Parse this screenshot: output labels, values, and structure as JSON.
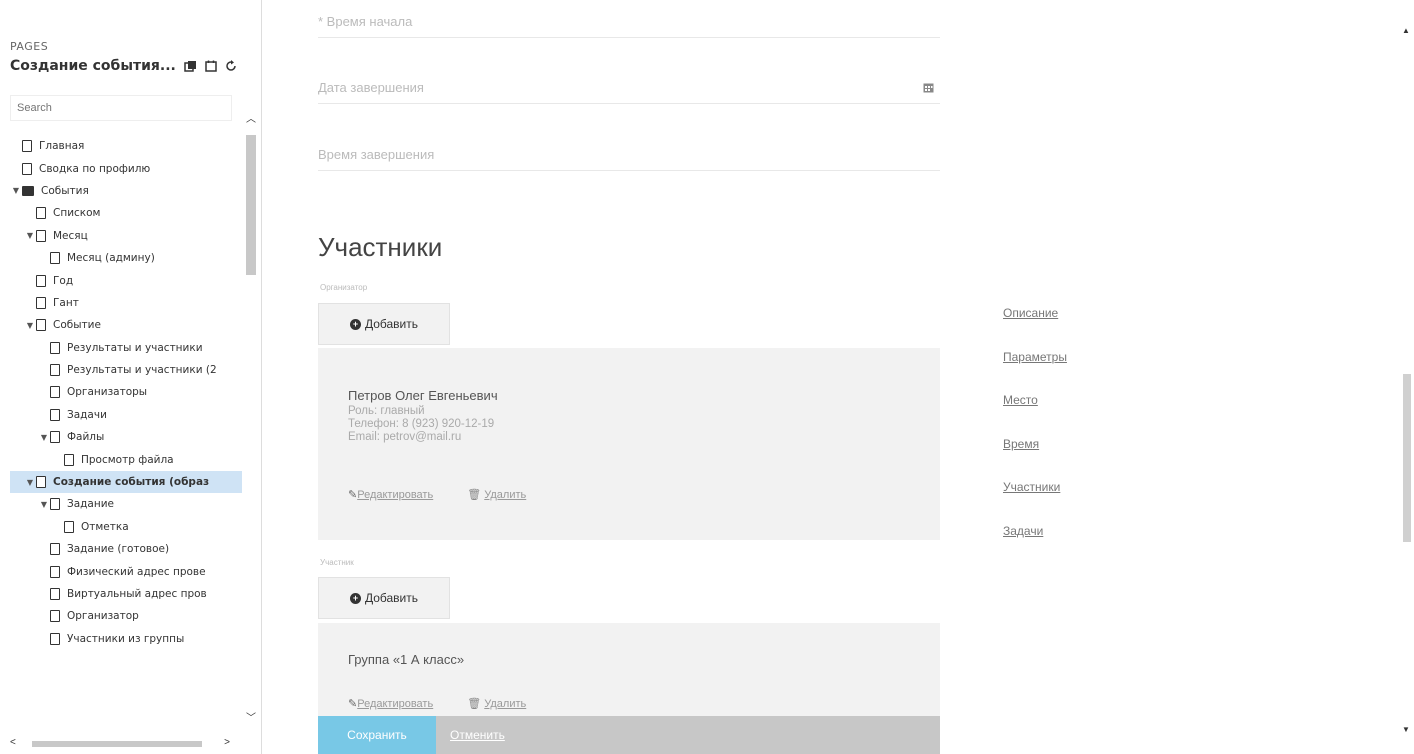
{
  "sidebar": {
    "pages_label": "PAGES",
    "page_title": "Создание события...",
    "search_placeholder": "Search",
    "tree": [
      {
        "label": "Главная",
        "indent": 0,
        "kind": "doc",
        "caret": ""
      },
      {
        "label": "Сводка по профилю",
        "indent": 0,
        "kind": "doc",
        "caret": ""
      },
      {
        "label": "События",
        "indent": 0,
        "kind": "folder",
        "caret": "▾"
      },
      {
        "label": "Списком",
        "indent": 1,
        "kind": "doc",
        "caret": ""
      },
      {
        "label": "Месяц",
        "indent": 1,
        "kind": "doc",
        "caret": "▾"
      },
      {
        "label": "Месяц (админу)",
        "indent": 2,
        "kind": "doc",
        "caret": ""
      },
      {
        "label": "Год",
        "indent": 1,
        "kind": "doc",
        "caret": ""
      },
      {
        "label": "Гант",
        "indent": 1,
        "kind": "doc",
        "caret": ""
      },
      {
        "label": "Событие",
        "indent": 1,
        "kind": "doc",
        "caret": "▾"
      },
      {
        "label": "Результаты и участники",
        "indent": 2,
        "kind": "doc",
        "caret": ""
      },
      {
        "label": "Результаты и участники (2",
        "indent": 2,
        "kind": "doc",
        "caret": ""
      },
      {
        "label": "Организаторы",
        "indent": 2,
        "kind": "doc",
        "caret": ""
      },
      {
        "label": "Задачи",
        "indent": 2,
        "kind": "doc",
        "caret": ""
      },
      {
        "label": "Файлы",
        "indent": 2,
        "kind": "doc",
        "caret": "▾"
      },
      {
        "label": "Просмотр файла",
        "indent": 3,
        "kind": "doc",
        "caret": ""
      },
      {
        "label": "Создание события (образ",
        "indent": 1,
        "kind": "doc",
        "caret": "▾",
        "selected": true
      },
      {
        "label": "Задание",
        "indent": 2,
        "kind": "doc",
        "caret": "▾"
      },
      {
        "label": "Отметка",
        "indent": 3,
        "kind": "doc",
        "caret": ""
      },
      {
        "label": "Задание (готовое)",
        "indent": 2,
        "kind": "doc",
        "caret": ""
      },
      {
        "label": "Физический адрес прове",
        "indent": 2,
        "kind": "doc",
        "caret": ""
      },
      {
        "label": "Виртуальный адрес пров",
        "indent": 2,
        "kind": "doc",
        "caret": ""
      },
      {
        "label": "Организатор",
        "indent": 2,
        "kind": "doc",
        "caret": ""
      },
      {
        "label": "Участники из группы",
        "indent": 2,
        "kind": "doc",
        "caret": ""
      }
    ]
  },
  "form": {
    "start_time_label": "* Время начала",
    "end_date_label": "Дата завершения",
    "end_time_label": "Время завершения",
    "participants_title": "Участники",
    "organizer_group_label": "Организатор",
    "participant_group_label": "Участник",
    "add_label": "Добавить",
    "organizer": {
      "name": "Петров Олег Евгеньевич",
      "role": "Роль: главный",
      "phone": "Телефон: 8 (923) 920-12-19",
      "email": "Email: petrov@mail.ru"
    },
    "participant": {
      "name": "Группа «1 А класс»"
    },
    "edit_label": "Редактировать",
    "delete_label": "Удалить",
    "save_label": "Сохранить",
    "cancel_label": "Отменить"
  },
  "side_nav": [
    "Описание",
    "Параметры",
    "Место",
    "Время",
    "Участники",
    "Задачи"
  ]
}
